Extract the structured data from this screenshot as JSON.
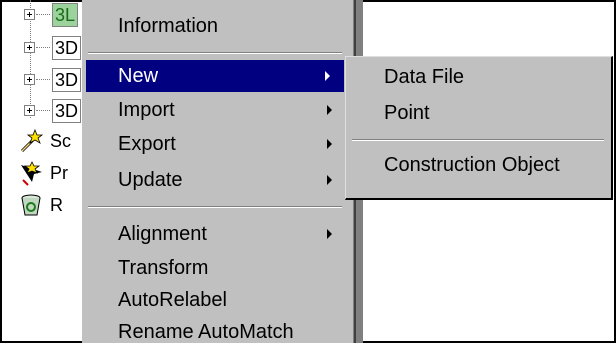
{
  "tree": {
    "nodes": [
      {
        "label": "3L",
        "selected": true
      },
      {
        "label": "3D",
        "selected": false
      },
      {
        "label": "3D",
        "selected": false
      },
      {
        "label": "3D",
        "selected": false
      }
    ],
    "tools": [
      {
        "label": "Sc",
        "icon": "pencil-plus-icon"
      },
      {
        "label": "Pr",
        "icon": "pointer-plus-icon"
      },
      {
        "label": "R",
        "icon": "recycle-bin-icon"
      }
    ]
  },
  "context_menu": {
    "items": [
      {
        "label": "Information"
      },
      {
        "label": "New",
        "submenu": true,
        "highlighted": true
      },
      {
        "label": "Import",
        "submenu": true
      },
      {
        "label": "Export",
        "submenu": true
      },
      {
        "label": "Update",
        "submenu": true
      },
      {
        "label": "Alignment",
        "submenu": true
      },
      {
        "label": "Transform"
      },
      {
        "label": "AutoRelabel"
      },
      {
        "label": "Rename AutoMatch"
      }
    ]
  },
  "submenu_new": {
    "items": [
      {
        "label": "Data File"
      },
      {
        "label": "Point"
      },
      {
        "label": "Construction Object"
      }
    ]
  },
  "colors": {
    "menu_bg": "#c0c0c0",
    "highlight": "#000080",
    "selected_node": "#9cd39c"
  }
}
